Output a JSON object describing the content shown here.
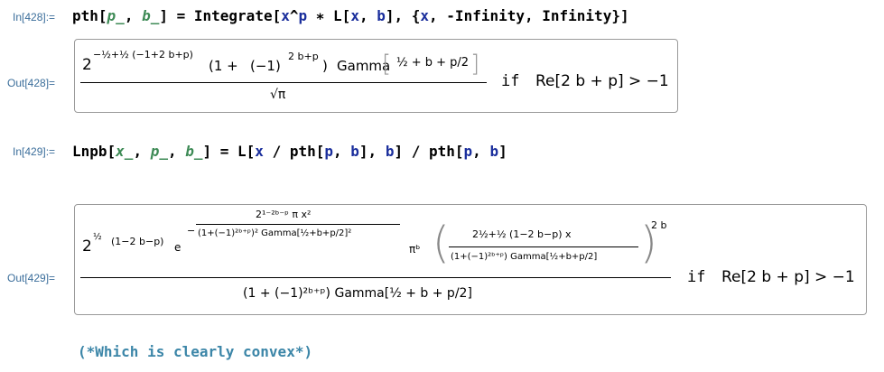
{
  "cells": [
    {
      "in_label": "In[428]:=",
      "out_label": "Out[428]="
    },
    {
      "in_label": "In[429]:=",
      "out_label": "Out[429]="
    }
  ],
  "in428": {
    "name": "pth",
    "lb": "[",
    "p": "p_",
    "comma": ", ",
    "b": "b_",
    "rb": "]",
    "assign": " = Integrate[",
    "x": "x",
    "pow": "^",
    "pp": "p",
    "star": " ∗ L[",
    "x2": "x",
    "c2": ", ",
    "b2": "b",
    "rest": "], {",
    "x3": "x",
    "tail": ", -Infinity, Infinity}]"
  },
  "out428": {
    "two": "2",
    "exp": "−½+½ (−1+2 b+p)",
    "paren_open": "(1 +",
    "neg1": "(−1)",
    "exp2": "2 b+p",
    "paren_close": ")",
    "gamma": "Gamma",
    "gamma_arg": "½ + b + p/2",
    "den": "√π",
    "cond": "if",
    "re": "Re[2 b + p] > −1"
  },
  "in429": {
    "name": "Lnpb",
    "x": "x_",
    "p": "p_",
    "b": "b_",
    "mid": "] = L[",
    "x2": "x",
    "div": " / pth[",
    "p2": "p",
    "b2": "b",
    "mid2": "], ",
    "b3": "b",
    "end1": "] / pth[",
    "p3": "p",
    "b4": "b",
    "end2": "]"
  },
  "out429": {
    "two": "2",
    "exp_a": "½",
    "exp_b": "(1−2 b−p)",
    "e": "e",
    "exp_num": "2¹⁻²ᵇ⁻ᵖ π x²",
    "exp_den": "(1+(−1)²ᵇ⁺ᵖ)² Gamma[½+b+p/2]²",
    "pib": "πᵇ",
    "big_num": "2½+½ (1−2 b−p) x",
    "big_den": "(1+(−1)²ᵇ⁺ᵖ) Gamma[½+b+p/2]",
    "outer_exp": "2 b",
    "den": "(1 + (−1)²ᵇ⁺ᵖ) Gamma[½ + b + p/2]",
    "cond": "if",
    "re": "Re[2 b + p] > −1"
  },
  "comment": "(*Which is clearly convex*)"
}
